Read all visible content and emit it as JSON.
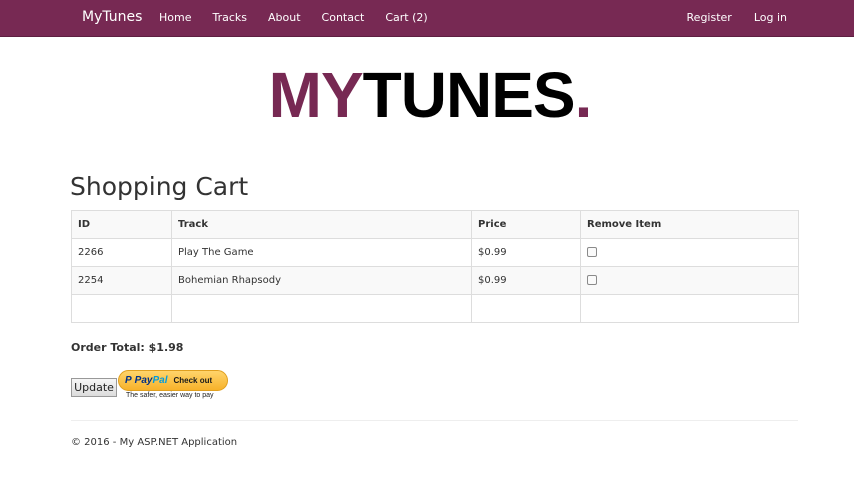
{
  "navbar": {
    "brand": "MyTunes",
    "left_links": [
      "Home",
      "Tracks",
      "About",
      "Contact",
      "Cart (2)"
    ],
    "right_links": [
      "Register",
      "Log in"
    ]
  },
  "logo": {
    "part1": "MY",
    "part2": "TUNES",
    "part3": "."
  },
  "page": {
    "title": "Shopping Cart"
  },
  "cart": {
    "headers": [
      "ID",
      "Track",
      "Price",
      "Remove Item"
    ],
    "rows": [
      {
        "id": "2266",
        "track": "Play The Game",
        "price": "$0.99"
      },
      {
        "id": "2254",
        "track": "Bohemian Rhapsody",
        "price": "$0.99"
      }
    ]
  },
  "order_total": "Order Total: $1.98",
  "buttons": {
    "update": "Update",
    "paypal_brand_p": "P",
    "paypal_brand_1": "Pay",
    "paypal_brand_2": "Pal",
    "paypal_checkout": "Check out",
    "paypal_tagline": "The safer, easier way to pay"
  },
  "footer": {
    "text": "© 2016 - My ASP.NET Application"
  },
  "colors": {
    "brand": "#772953"
  }
}
